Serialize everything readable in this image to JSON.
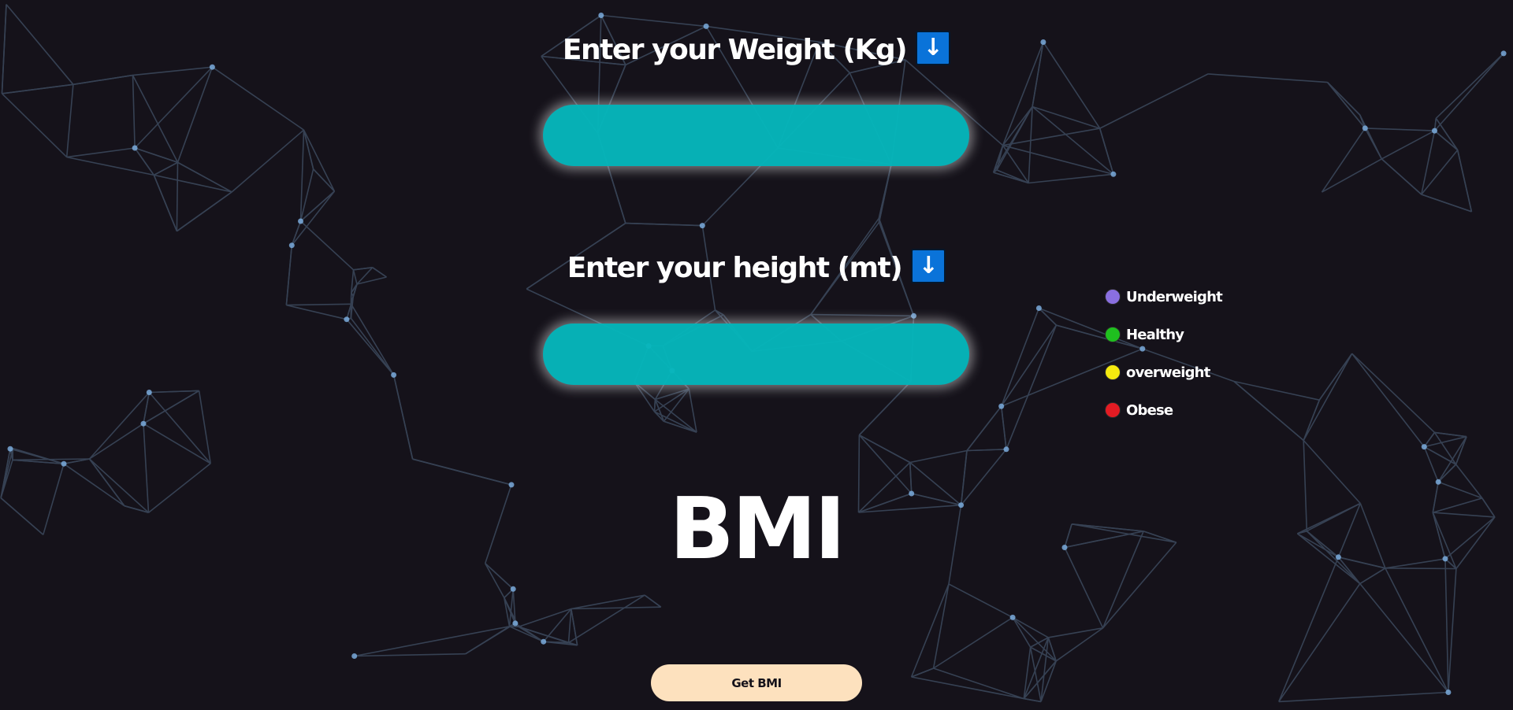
{
  "weight": {
    "label": "Enter your Weight (Kg)",
    "arrow_icon": "↓",
    "value": "",
    "placeholder": ""
  },
  "height": {
    "label": "Enter your height (mt)",
    "arrow_icon": "↓",
    "value": "",
    "placeholder": ""
  },
  "result": {
    "text": "BMI"
  },
  "button": {
    "label": "Get BMI"
  },
  "legend": {
    "items": [
      {
        "label": "Underweight",
        "color": "#8a6fe0"
      },
      {
        "label": "Healthy",
        "color": "#1fc01f"
      },
      {
        "label": "overweight",
        "color": "#f5ea0f"
      },
      {
        "label": "Obese",
        "color": "#e31b23"
      }
    ]
  },
  "colors": {
    "background": "#15121a",
    "input_fill": "#06b7bc",
    "button_fill": "#fde1be",
    "arrow_box": "#0a73d9",
    "network_lines": "#3c4a5e",
    "network_nodes": "#7fb3e6"
  },
  "icons": {
    "weight_arrow": "down-arrow-icon",
    "height_arrow": "down-arrow-icon"
  }
}
